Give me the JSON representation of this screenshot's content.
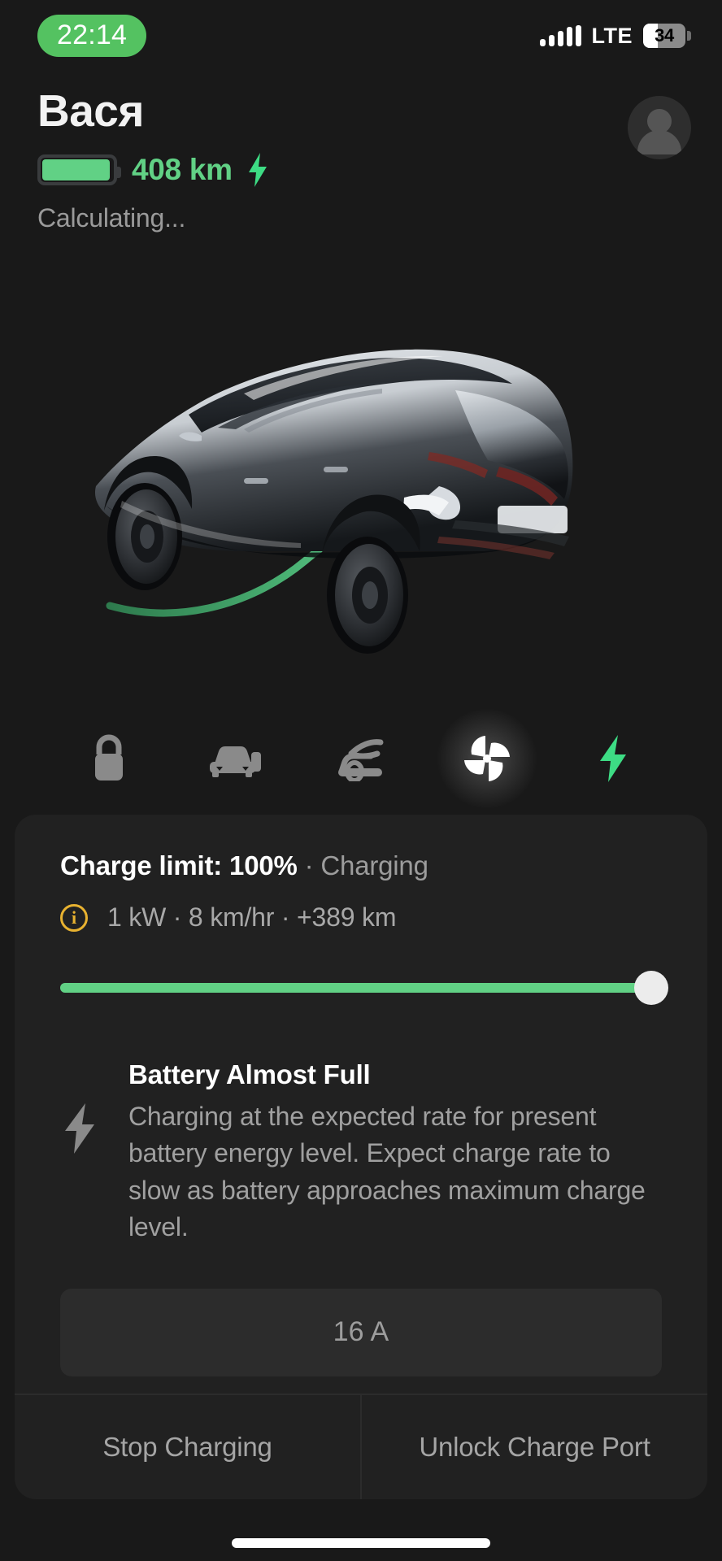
{
  "status_bar": {
    "time": "22:14",
    "network_label": "LTE",
    "battery_percent": "34",
    "signal_bars": 5
  },
  "header": {
    "car_name": "Вася",
    "range": "408 km",
    "charging_bolt": "bolt-icon",
    "status_text": "Calculating...",
    "battery_level_percent": 97
  },
  "controls": [
    {
      "name": "lock",
      "label": "Lock",
      "active": false
    },
    {
      "name": "trunk",
      "label": "Trunk",
      "active": false
    },
    {
      "name": "frunk",
      "label": "Frunk",
      "active": false
    },
    {
      "name": "climate",
      "label": "Climate",
      "active": true
    },
    {
      "name": "charging",
      "label": "Charging",
      "active": false
    }
  ],
  "charge_card": {
    "limit_label": "Charge limit: 100%",
    "separator": "·",
    "charge_state": "Charging",
    "stats": "1 kW · 8 km/hr · +389 km",
    "info_glyph": "i",
    "slider_value_percent": 100,
    "message_title": "Battery Almost Full",
    "message_body": "Charging at the expected rate for present battery energy level. Expect charge rate to slow as battery approaches maximum charge level.",
    "amperage": "16 A",
    "actions": [
      {
        "label": "Stop Charging"
      },
      {
        "label": "Unlock Charge Port"
      }
    ]
  },
  "colors": {
    "accent_green": "#61d185",
    "time_pill_green": "#54c261",
    "info_amber": "#e8b230",
    "card_bg": "#212121",
    "page_bg": "#191919"
  }
}
